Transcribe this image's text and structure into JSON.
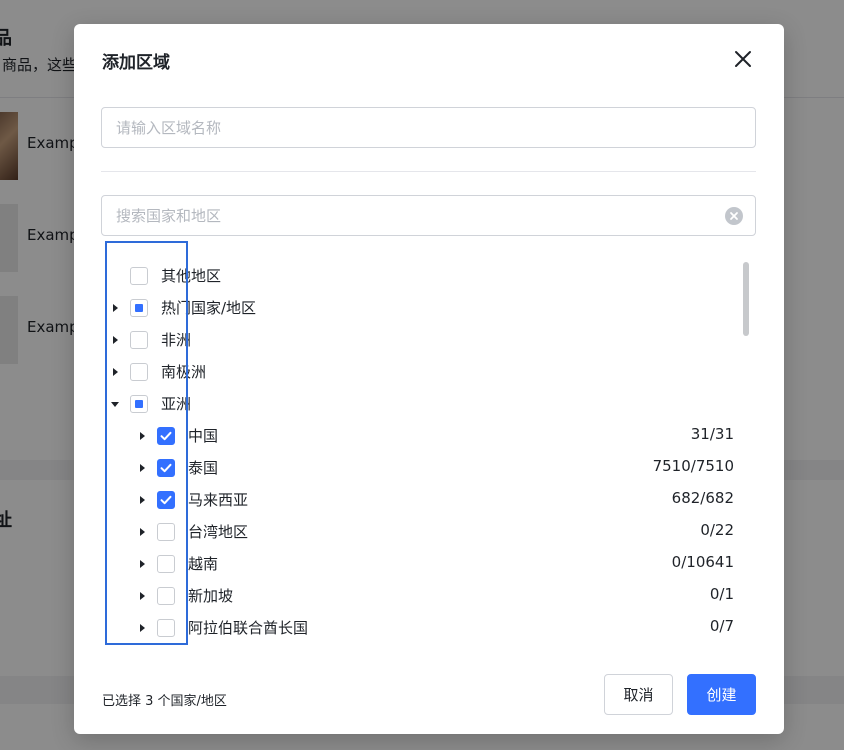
{
  "background": {
    "title": "品",
    "subtitle": "商品，这些",
    "rows": [
      {
        "text": "Examp"
      },
      {
        "text": "Examp"
      },
      {
        "text": "Examp"
      }
    ],
    "side_char": "址"
  },
  "modal": {
    "title": "添加区域",
    "name_input": {
      "placeholder": "请输入区域名称",
      "value": ""
    },
    "search_input": {
      "placeholder": "搜索国家和地区",
      "value": ""
    },
    "tree": [
      {
        "label": "其他地区",
        "level": 0,
        "has_children": false,
        "expanded": false,
        "state": "unchecked",
        "count": ""
      },
      {
        "label": "热门国家/地区",
        "level": 0,
        "has_children": true,
        "expanded": false,
        "state": "partial",
        "count": ""
      },
      {
        "label": "非洲",
        "level": 0,
        "has_children": true,
        "expanded": false,
        "state": "unchecked",
        "count": ""
      },
      {
        "label": "南极洲",
        "level": 0,
        "has_children": true,
        "expanded": false,
        "state": "unchecked",
        "count": ""
      },
      {
        "label": "亚洲",
        "level": 0,
        "has_children": true,
        "expanded": true,
        "state": "partial",
        "count": ""
      },
      {
        "label": "中国",
        "level": 1,
        "has_children": true,
        "expanded": false,
        "state": "checked",
        "count": "31/31"
      },
      {
        "label": "泰国",
        "level": 1,
        "has_children": true,
        "expanded": false,
        "state": "checked",
        "count": "7510/7510"
      },
      {
        "label": "马来西亚",
        "level": 1,
        "has_children": true,
        "expanded": false,
        "state": "checked",
        "count": "682/682"
      },
      {
        "label": "台湾地区",
        "level": 1,
        "has_children": true,
        "expanded": false,
        "state": "unchecked",
        "count": "0/22"
      },
      {
        "label": "越南",
        "level": 1,
        "has_children": true,
        "expanded": false,
        "state": "unchecked",
        "count": "0/10641"
      },
      {
        "label": "新加坡",
        "level": 1,
        "has_children": true,
        "expanded": false,
        "state": "unchecked",
        "count": "0/1"
      },
      {
        "label": "阿拉伯联合酋长国",
        "level": 1,
        "has_children": true,
        "expanded": false,
        "state": "unchecked",
        "count": "0/7"
      }
    ],
    "footer_status": "已选择 3 个国家/地区",
    "cancel_label": "取消",
    "create_label": "创建"
  },
  "colors": {
    "primary": "#3370ff",
    "highlight_border": "#2e6bd9",
    "overlay": "rgba(0,0,0,0.45)"
  },
  "icons": {
    "close": "close-icon",
    "clear": "clear-circle-icon",
    "collapsed": "caret-right-icon",
    "expanded": "caret-down-icon",
    "check": "check-icon"
  }
}
